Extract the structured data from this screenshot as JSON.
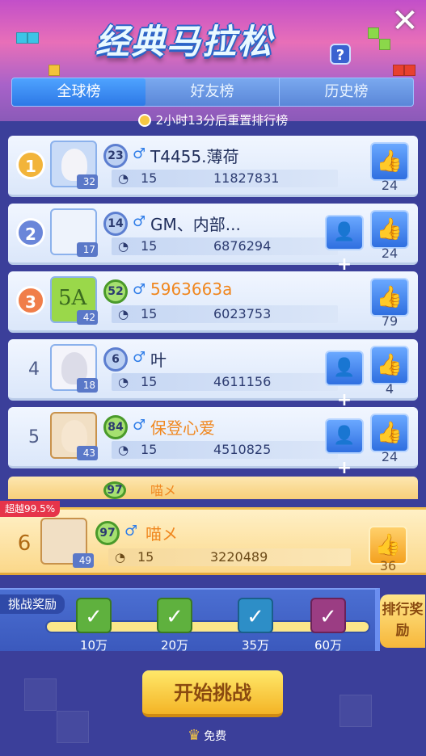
{
  "header": {
    "title": "经典马拉松",
    "help_label": "?",
    "close_label": "✕"
  },
  "tabs": [
    {
      "label": "全球榜",
      "active": true
    },
    {
      "label": "好友榜",
      "active": false
    },
    {
      "label": "历史榜",
      "active": false
    }
  ],
  "reset_text": "2小时13分后重置排行榜",
  "rows": [
    {
      "rank": "1",
      "badge": "23",
      "level": "32",
      "name": "T4455.薄荷",
      "lines": "15",
      "score": "11827831",
      "likes": "24",
      "add_friend": false,
      "name_color": "default"
    },
    {
      "rank": "2",
      "badge": "14",
      "level": "17",
      "name": "GM、内部...",
      "lines": "15",
      "score": "6876294",
      "likes": "24",
      "add_friend": true,
      "name_color": "default"
    },
    {
      "rank": "3",
      "badge": "52",
      "level": "42",
      "name": "5963663a",
      "lines": "15",
      "score": "6023753",
      "likes": "79",
      "add_friend": false,
      "name_color": "orange",
      "avatar_text": "5A"
    },
    {
      "rank": "4",
      "badge": "6",
      "level": "18",
      "name": "叶",
      "lines": "15",
      "score": "4611156",
      "likes": "4",
      "add_friend": true,
      "name_color": "default"
    },
    {
      "rank": "5",
      "badge": "84",
      "level": "43",
      "name": "保登心爱",
      "lines": "15",
      "score": "4510825",
      "likes": "24",
      "add_friend": true,
      "name_color": "orange"
    }
  ],
  "partial_row": {
    "badge": "97",
    "name": "喵メ"
  },
  "me": {
    "exceed": "超越99.5%",
    "rank": "6",
    "badge": "97",
    "level": "49",
    "name": "喵メ",
    "lines": "15",
    "score": "3220489",
    "likes": "36"
  },
  "reward": {
    "label": "挑战奖励",
    "milestones": [
      "10万",
      "20万",
      "35万",
      "60万"
    ],
    "claimed": [
      true,
      true,
      true,
      true
    ],
    "rank_reward_label": "排行奖励"
  },
  "start_button": "开始挑战",
  "free_text": "免费",
  "colors": {
    "accent_blue": "#2f6fe0",
    "gold": "#f4b426",
    "orange_name": "#f0871f"
  }
}
